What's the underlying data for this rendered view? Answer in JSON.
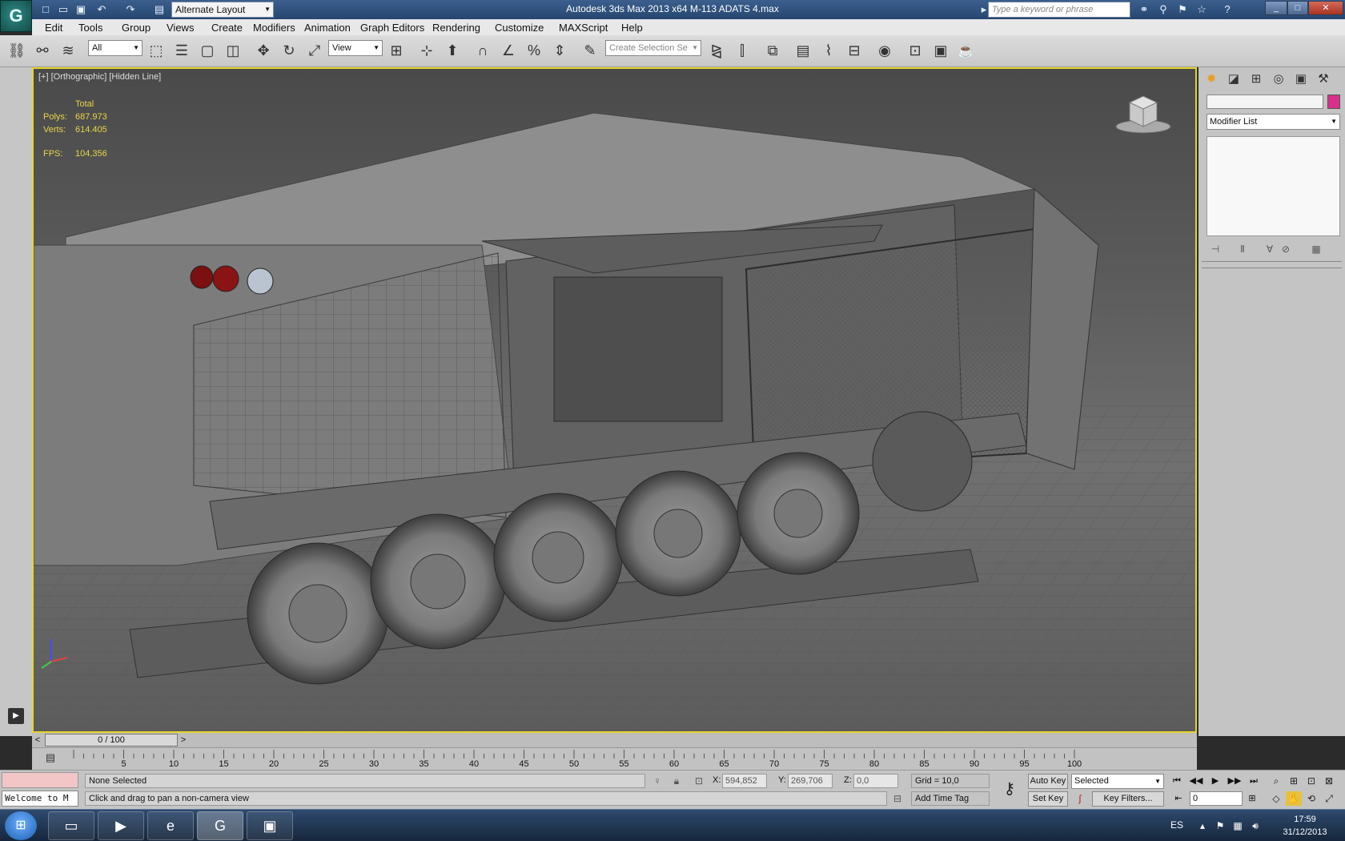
{
  "window": {
    "title": "Autodesk 3ds Max  2013 x64      M-113 ADATS 4.max",
    "workspace": "Alternate Layout",
    "search_placeholder": "Type a keyword or phrase",
    "app_logo": "3ds-max-logo"
  },
  "menu": [
    "Edit",
    "Tools",
    "Group",
    "Views",
    "Create",
    "Modifiers",
    "Animation",
    "Graph Editors",
    "Rendering",
    "Customize",
    "MAXScript",
    "Help"
  ],
  "toolbar": {
    "selection_filter": "All",
    "reference_coord": "View",
    "named_selection": "Create Selection Se"
  },
  "viewport": {
    "label": "[+] [Orthographic] [Hidden Line]",
    "stats": {
      "header": "Total",
      "polys_label": "Polys:",
      "polys": "687.973",
      "verts_label": "Verts:",
      "verts": "614.405",
      "fps_label": "FPS:",
      "fps": "104,356"
    },
    "border_color": "#e6d628"
  },
  "command_panel": {
    "modifier_list": "Modifier List",
    "object_color": "#d8308a"
  },
  "timeline": {
    "slider": "0 / 100",
    "ticks": [
      "5",
      "10",
      "15",
      "20",
      "25",
      "30",
      "35",
      "40",
      "45",
      "50",
      "55",
      "60",
      "65",
      "70",
      "75",
      "80",
      "85",
      "90",
      "95",
      "100"
    ]
  },
  "status": {
    "listener": "Welcome to M",
    "selection": "None Selected",
    "prompt": "Click and drag to pan a non-camera view",
    "x_label": "X:",
    "x": "594,852",
    "y_label": "Y:",
    "y": "269,706",
    "z_label": "Z:",
    "z": "0,0",
    "grid": "Grid = 10,0",
    "add_time_tag": "Add Time Tag",
    "auto_key": "Auto Key",
    "set_key": "Set Key",
    "key_mode": "Selected",
    "key_filters": "Key Filters...",
    "frame": "0"
  },
  "taskbar": {
    "language": "ES",
    "time": "17:59",
    "date": "31/12/2013"
  }
}
